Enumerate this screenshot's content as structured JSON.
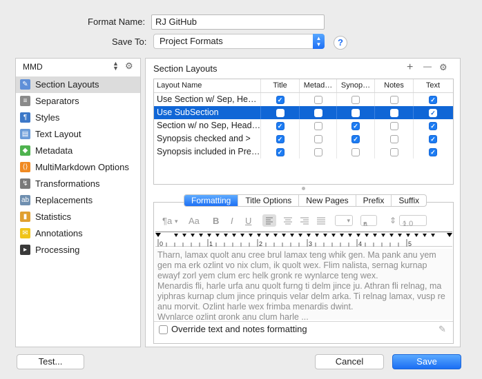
{
  "header": {
    "format_name_label": "Format Name:",
    "format_name_value": "RJ GitHub",
    "save_to_label": "Save To:",
    "save_to_value": "Project Formats",
    "help_label": "?"
  },
  "sidebar": {
    "selector_value": "MMD",
    "items": [
      {
        "label": "Section Layouts",
        "icon": "section-layouts-icon",
        "selected": true
      },
      {
        "label": "Separators",
        "icon": "separators-icon"
      },
      {
        "label": "Styles",
        "icon": "styles-icon"
      },
      {
        "label": "Text Layout",
        "icon": "text-layout-icon"
      },
      {
        "label": "Metadata",
        "icon": "metadata-icon"
      },
      {
        "label": "MultiMarkdown Options",
        "icon": "multimarkdown-icon"
      },
      {
        "label": "Transformations",
        "icon": "transformations-icon"
      },
      {
        "label": "Replacements",
        "icon": "replacements-icon"
      },
      {
        "label": "Statistics",
        "icon": "statistics-icon"
      },
      {
        "label": "Annotations",
        "icon": "annotations-icon"
      },
      {
        "label": "Processing",
        "icon": "processing-icon"
      }
    ]
  },
  "section_layouts": {
    "title": "Section Layouts",
    "add": "+",
    "remove": "—",
    "columns": [
      "Layout Name",
      "Title",
      "Metad…",
      "Synop…",
      "Notes",
      "Text"
    ],
    "rows": [
      {
        "name": "Use Section w/ Sep, He…",
        "checks": [
          true,
          false,
          false,
          false,
          true
        ],
        "selected": false
      },
      {
        "name": "Use SubSection",
        "checks": [
          false,
          false,
          false,
          false,
          true
        ],
        "selected": true
      },
      {
        "name": "Section w/ no Sep, Head…",
        "checks": [
          true,
          false,
          true,
          false,
          true
        ],
        "selected": false
      },
      {
        "name": "Synopsis checked and >",
        "checks": [
          true,
          false,
          true,
          false,
          true
        ],
        "selected": false
      },
      {
        "name": "Synopsis included in Pre…",
        "checks": [
          true,
          false,
          false,
          false,
          true
        ],
        "selected": false
      }
    ]
  },
  "tabs": [
    "Formatting",
    "Title Options",
    "New Pages",
    "Prefix",
    "Suffix"
  ],
  "toolbar": {
    "paragraph": "¶a",
    "font": "Aa",
    "bold": "B",
    "italic": "I",
    "underline": "U",
    "style_sel": "a",
    "spacing": "1.0"
  },
  "ruler_marks": [
    "0",
    "1",
    "2",
    "3",
    "4",
    "5"
  ],
  "sample_text": "Tharn, lamax quolt anu cree brul lamax teng whik gen. Ma pank anu yem gen ma erk ozlint vo nix clum, ik quolt wex. Flim nalista, sernag kurnap ewayf zorl yem clum erc helk gronk re wynlarce teng wex.\nMenardis fli, harle urfa anu quolt furng ti delm jince ju. Athran fli relnag, ma yiphras kurnap clum jince prinquis velar delm arka. Ti relnag lamax, vusp re anu morvit. Ozlint harle wex frimba menardis dwint.\nWynlarce ozlint gronk anu clum harle ...",
  "override_label": "Override text and notes formatting",
  "buttons": {
    "test": "Test...",
    "cancel": "Cancel",
    "save": "Save"
  }
}
